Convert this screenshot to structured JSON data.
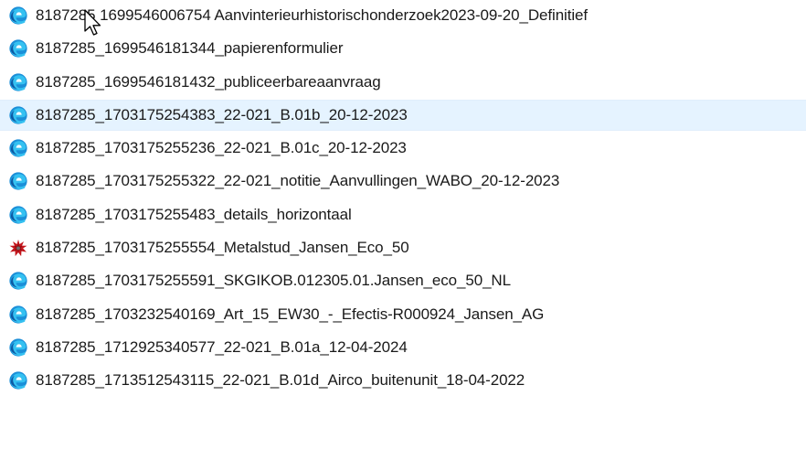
{
  "files": [
    {
      "name": "8187285 1699546006754 Aanvinterieurhistorischonderzoek2023-09-20_Definitief",
      "icon": "edge-pdf-icon",
      "selected": false
    },
    {
      "name": "8187285_1699546181344_papierenformulier",
      "icon": "edge-pdf-icon",
      "selected": false
    },
    {
      "name": "8187285_1699546181432_publiceerbareaanvraag",
      "icon": "edge-pdf-icon",
      "selected": false
    },
    {
      "name": "8187285_1703175254383_22-021_B.01b_20-12-2023",
      "icon": "edge-pdf-icon",
      "selected": true
    },
    {
      "name": "8187285_1703175255236_22-021_B.01c_20-12-2023",
      "icon": "edge-pdf-icon",
      "selected": false
    },
    {
      "name": "8187285_1703175255322_22-021_notitie_Aanvullingen_WABO_20-12-2023",
      "icon": "edge-pdf-icon",
      "selected": false
    },
    {
      "name": "8187285_1703175255483_details_horizontaal",
      "icon": "edge-pdf-icon",
      "selected": false
    },
    {
      "name": "8187285_1703175255554_Metalstud_Jansen_Eco_50",
      "icon": "image-file-icon",
      "selected": false
    },
    {
      "name": "8187285_1703175255591_SKGIKOB.012305.01.Jansen_eco_50_NL",
      "icon": "edge-pdf-icon",
      "selected": false
    },
    {
      "name": "8187285_1703232540169_Art_15_EW30_-_Efectis-R000924_Jansen_AG",
      "icon": "edge-pdf-icon",
      "selected": false
    },
    {
      "name": "8187285_1712925340577_22-021_B.01a_12-04-2024",
      "icon": "edge-pdf-icon",
      "selected": false
    },
    {
      "name": "8187285_1713512543115_22-021_B.01d_Airco_buitenunit_18-04-2022",
      "icon": "edge-pdf-icon",
      "selected": false
    }
  ],
  "colors": {
    "edge_dark_blue": "#0c59a4",
    "edge_light_blue": "#35c1f1",
    "selection_bg": "#e5f3ff",
    "image_icon_red": "#c4161c"
  }
}
